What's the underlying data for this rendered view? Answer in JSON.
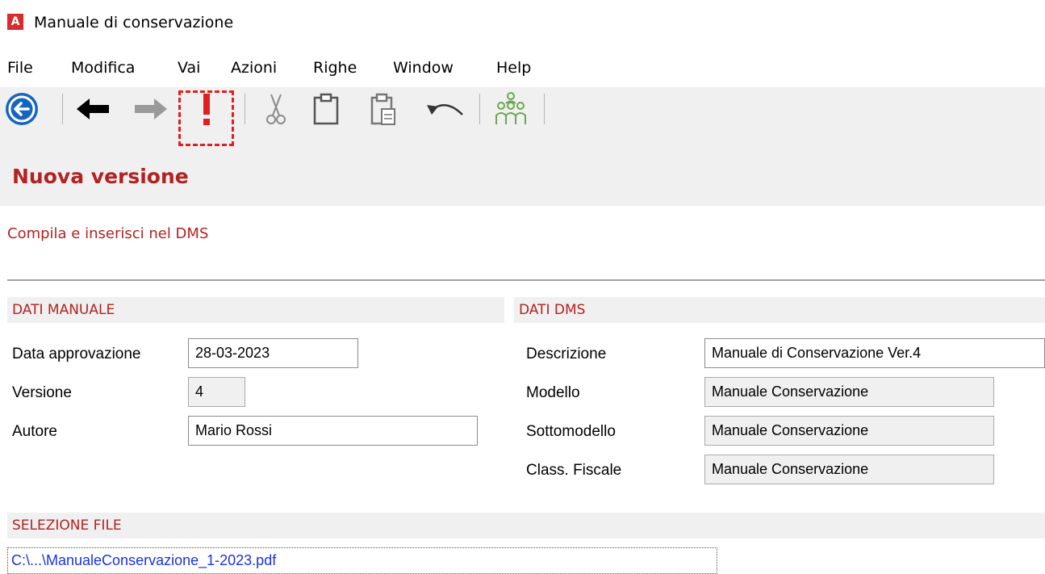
{
  "window": {
    "app_icon_letter": "A",
    "title": "Manuale di conservazione"
  },
  "menu": {
    "items": [
      "File",
      "Modifica",
      "Vai",
      "Azioni",
      "Righe",
      "Window",
      "Help"
    ]
  },
  "toolbar": {
    "buttons": [
      {
        "icon": "back-circle-icon",
        "enabled": true
      },
      {
        "icon": "arrow-left-icon",
        "enabled": true
      },
      {
        "icon": "arrow-right-icon",
        "enabled": false
      },
      {
        "icon": "exclamation-icon",
        "enabled": true,
        "highlighted": true
      },
      {
        "icon": "scissors-icon",
        "enabled": false
      },
      {
        "icon": "clipboard-icon",
        "enabled": false
      },
      {
        "icon": "paste-special-icon",
        "enabled": false
      },
      {
        "icon": "undo-icon",
        "enabled": false
      },
      {
        "icon": "group-users-icon",
        "enabled": true
      }
    ],
    "highlight_color": "#e02020"
  },
  "page": {
    "title": "Nuova versione",
    "subtitle": "Compila e inserisci nel DMS",
    "accent_color": "#b22222"
  },
  "dati_manuale": {
    "section_title": "DATI MANUALE",
    "fields": [
      {
        "label": "Data approvazione",
        "value": "28-03-2023",
        "readonly": false
      },
      {
        "label": "Versione",
        "value": "4",
        "readonly": true
      },
      {
        "label": "Autore",
        "value": "Mario Rossi",
        "readonly": false
      }
    ]
  },
  "dati_dms": {
    "section_title": "DATI DMS",
    "fields": [
      {
        "label": "Descrizione",
        "value": "Manuale di Conservazione Ver.4",
        "readonly": false
      },
      {
        "label": "Modello",
        "value": "Manuale Conservazione",
        "readonly": true
      },
      {
        "label": "Sottomodello",
        "value": "Manuale Conservazione",
        "readonly": true
      },
      {
        "label": "Class. Fiscale",
        "value": "Manuale Conservazione",
        "readonly": true
      }
    ]
  },
  "selezione_file": {
    "section_title": "SELEZIONE FILE",
    "path_visible": "C:\\...\\ManualeConservazione_1-2023.pdf"
  }
}
